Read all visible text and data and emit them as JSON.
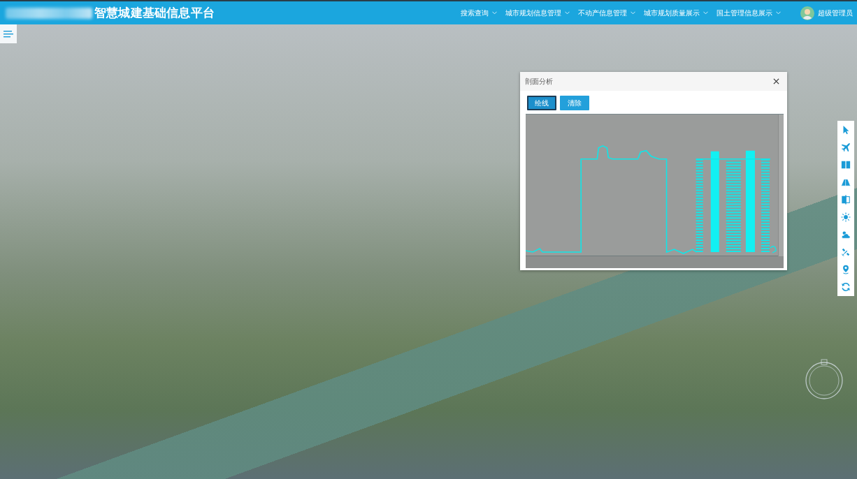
{
  "header": {
    "title": "智慧城建基础信息平台",
    "menu": [
      {
        "label": "搜索查询"
      },
      {
        "label": "城市规划信息管理"
      },
      {
        "label": "不动产信息管理"
      },
      {
        "label": "城市规划质量展示"
      },
      {
        "label": "国土管理信息展示"
      }
    ],
    "user_name": "超级管理员"
  },
  "dialog": {
    "title": "剖面分析",
    "buttons": [
      {
        "label": "绘线",
        "selected": true
      },
      {
        "label": "清除",
        "selected": false
      }
    ]
  }
}
